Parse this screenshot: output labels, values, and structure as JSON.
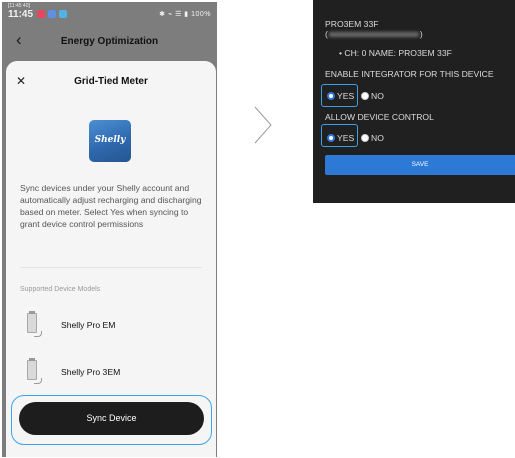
{
  "status_bar": {
    "date": "[11:45 40]",
    "time": "11:45",
    "right_icons": "✱ ⌁ ☰ ▮ 100%",
    "dot_colors": [
      "#e8465e",
      "#5f8fe6",
      "#4fb3e8"
    ]
  },
  "nav": {
    "title": "Energy Optimization"
  },
  "sheet": {
    "title": "Grid-Tied Meter",
    "logo_text": "Shelly",
    "description": "Sync devices under your Shelly account and automatically adjust recharging and discharging based on meter. Select Yes when syncing to grant device control permissions",
    "supported_label": "Supported Device Models",
    "devices": [
      {
        "label": "Shelly Pro EM"
      },
      {
        "label": "Shelly Pro 3EM"
      }
    ],
    "sync_button": "Sync Device"
  },
  "panel": {
    "device_name": "PRO3EM 33F",
    "paren_open": "(",
    "paren_close": ")",
    "channel_line": "• CH: 0 NAME: PRO3EM 33F",
    "integrator_label": "ENABLE INTEGRATOR FOR THIS DEVICE",
    "control_label": "ALLOW DEVICE CONTROL",
    "yes": "YES",
    "no": "NO",
    "save": "SAVE"
  },
  "colors": {
    "accent": "#2d79d6",
    "highlight": "#3fa3e8",
    "button_dark": "#1d1d1d"
  }
}
